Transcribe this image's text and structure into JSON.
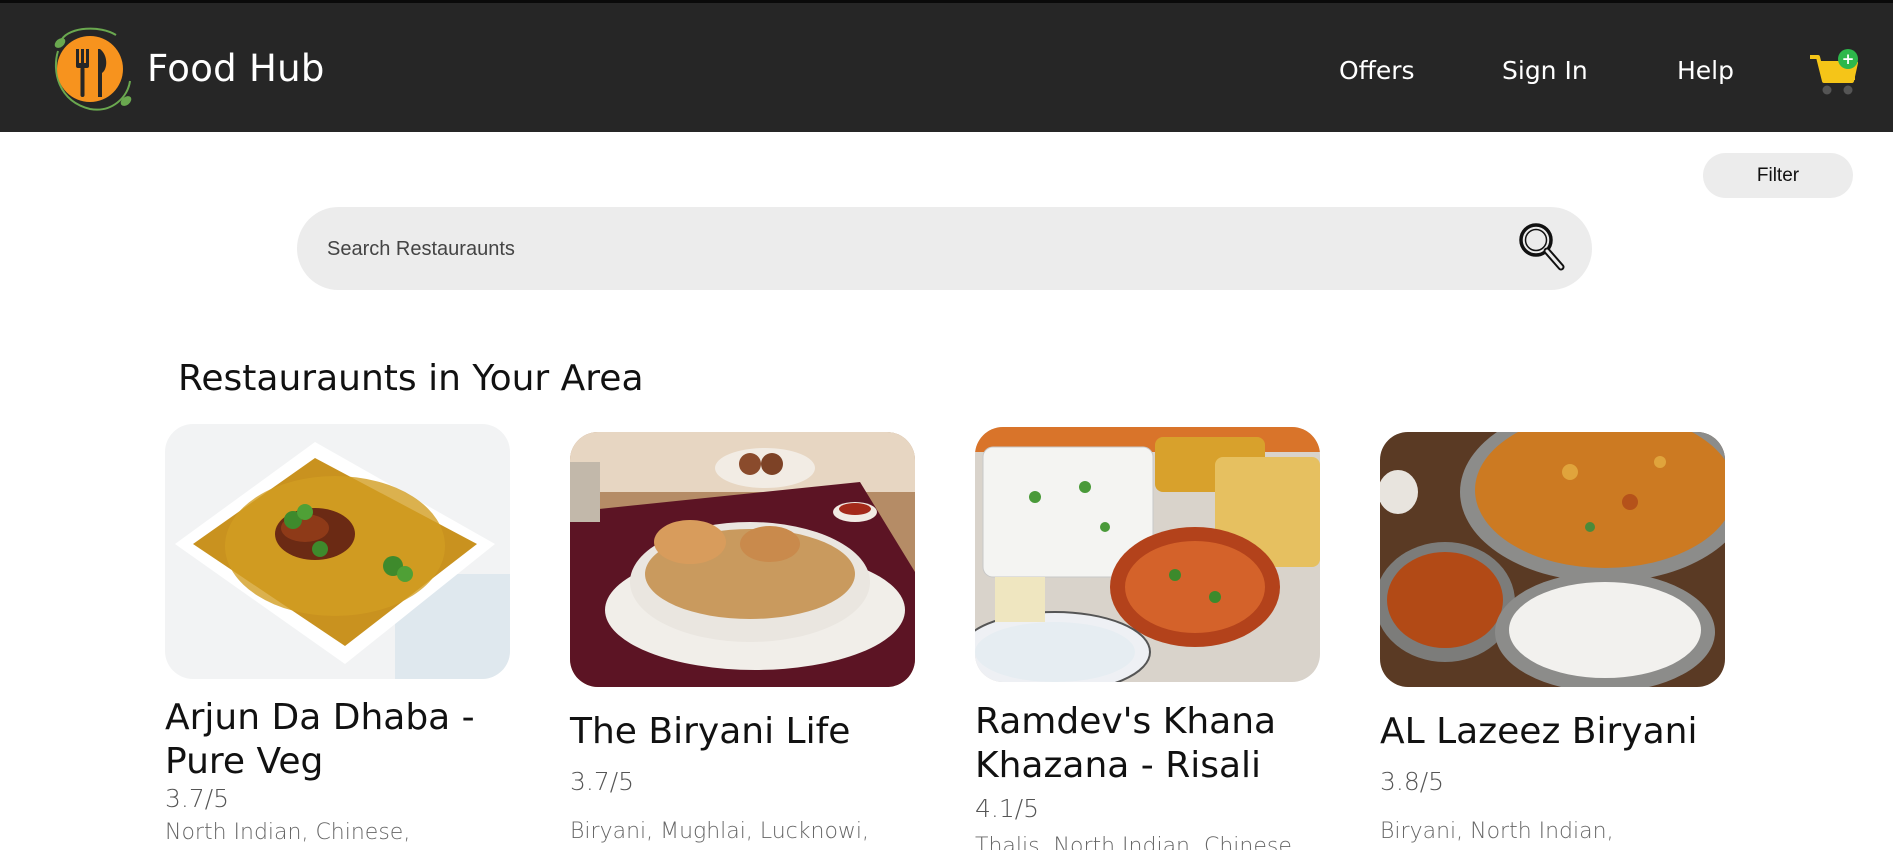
{
  "header": {
    "brand": "Food Hub",
    "nav": [
      "Offers",
      "Sign In",
      "Help"
    ],
    "cart_icon": "cart-icon",
    "cart_badge": "+",
    "logo_icon": "fork-knife-icon",
    "colors": {
      "bar": "#262626",
      "logo_orange": "#f7931e",
      "badge_green": "#2db84b",
      "cart_yellow": "#f5c518"
    }
  },
  "filter": {
    "label": "Filter"
  },
  "search": {
    "placeholder": "Search Restauraunts",
    "icon": "search-icon"
  },
  "section": {
    "title": "Restauraunts in Your Area"
  },
  "restaurants": [
    {
      "name_line1": "Arjun Da Dhaba -",
      "name_line2": "Pure Veg",
      "rating": "3.7/5",
      "cuisine": "North Indian, Chinese,"
    },
    {
      "name_line1": "The Biryani Life",
      "name_line2": "",
      "rating": "3.7/5",
      "cuisine": "Biryani, Mughlai, Lucknowi,"
    },
    {
      "name_line1": "Ramdev's Khana",
      "name_line2": "Khazana - Risali",
      "rating": "4.1/5",
      "cuisine": "Thalis, North Indian, Chinese,"
    },
    {
      "name_line1": "AL Lazeez Biryani",
      "name_line2": "",
      "rating": "3.8/5",
      "cuisine": "Biryani, North Indian,"
    }
  ]
}
